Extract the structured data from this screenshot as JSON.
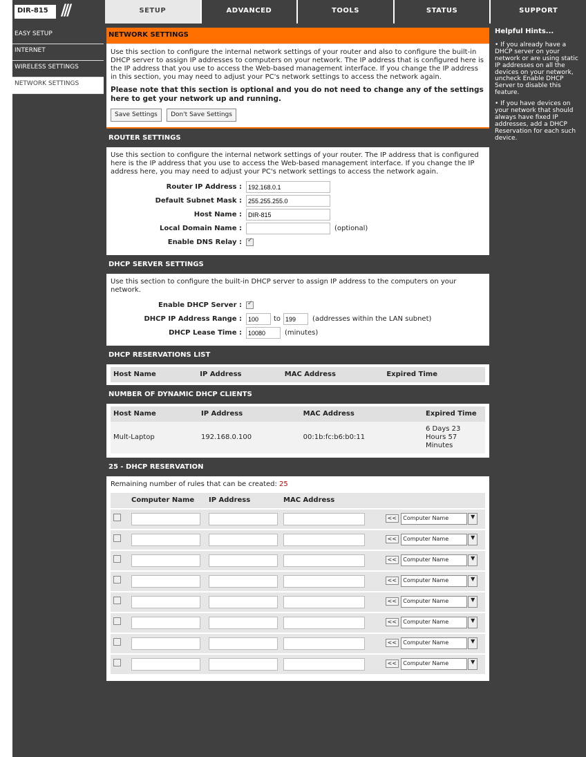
{
  "logo": {
    "model": "DIR-815"
  },
  "tabs": [
    "SETUP",
    "ADVANCED",
    "TOOLS",
    "STATUS",
    "SUPPORT"
  ],
  "sidebar": {
    "items": [
      {
        "label": "EASY SETUP"
      },
      {
        "label": "INTERNET"
      },
      {
        "label": "WIRELESS SETTINGS"
      },
      {
        "label": "NETWORK SETTINGS"
      }
    ]
  },
  "network": {
    "title": "NETWORK SETTINGS",
    "desc": "Use this section to configure the internal network settings of your router and also to configure the built-in DHCP server to assign IP addresses to computers on your network. The IP address that is configured here is the IP address that you use to access the Web-based management interface. If you change the IP address in this section, you may need to adjust your PC's network settings to access the network again.",
    "note": "Please note that this section is optional and you do not need to change any of the settings here to get your network up and running.",
    "save_label": "Save Settings",
    "dont_save_label": "Don't Save Settings"
  },
  "router": {
    "title": "ROUTER SETTINGS",
    "desc": "Use this section to configure the internal network settings of your router. The IP address that is configured here is the IP address that you use to access the Web-based management interface. If you change the IP address here, you may need to adjust your PC's network settings to access the network again.",
    "ip_label": "Router IP Address :",
    "ip_value": "192.168.0.1",
    "mask_label": "Default Subnet Mask :",
    "mask_value": "255.255.255.0",
    "host_label": "Host Name :",
    "host_value": "DIR-815",
    "domain_label": "Local Domain Name :",
    "domain_value": "",
    "optional": "(optional)",
    "dns_label": "Enable DNS Relay :"
  },
  "dhcp": {
    "title": "DHCP SERVER SETTINGS",
    "desc": "Use this section to configure the built-in DHCP server to assign IP address to the computers on your network.",
    "enable_label": "Enable DHCP Server :",
    "range_label": "DHCP IP Address Range :",
    "range_start": "100",
    "to": "to",
    "range_end": "199",
    "range_note": "(addresses within the LAN subnet)",
    "lease_label": "DHCP Lease Time :",
    "lease_value": "10080",
    "lease_unit": "(minutes)"
  },
  "reservations_list": {
    "title": "DHCP RESERVATIONS LIST",
    "headers": [
      "Host Name",
      "IP Address",
      "MAC Address",
      "Expired Time"
    ]
  },
  "clients": {
    "title": "NUMBER OF DYNAMIC DHCP CLIENTS",
    "headers": [
      "Host Name",
      "IP Address",
      "MAC Address",
      "Expired Time"
    ],
    "rows": [
      {
        "host": "Mult-Laptop",
        "ip": "192.168.0.100",
        "mac": "00:1b:fc:b6:b0:11",
        "expires": "6 Days 23 Hours 57 Minutes"
      }
    ]
  },
  "reservation": {
    "title": "25 - DHCP RESERVATION",
    "remaining_label": "Remaining number of rules that can be created:",
    "remaining_value": "25",
    "headers": {
      "computer": "Computer Name",
      "ip": "IP Address",
      "mac": "MAC Address"
    },
    "copy_label": "<<",
    "select_label": "Computer Name",
    "select_arrow": "▼"
  },
  "help": {
    "title": "Helpful Hints...",
    "hint1": "• If you already have a DHCP server on your network or are using static IP addresses on all the devices on your network, uncheck Enable DHCP Server to disable this feature.",
    "hint2": "• If you have devices on your network that should always have fixed IP addresses, add a DHCP Reservation for each such device."
  }
}
